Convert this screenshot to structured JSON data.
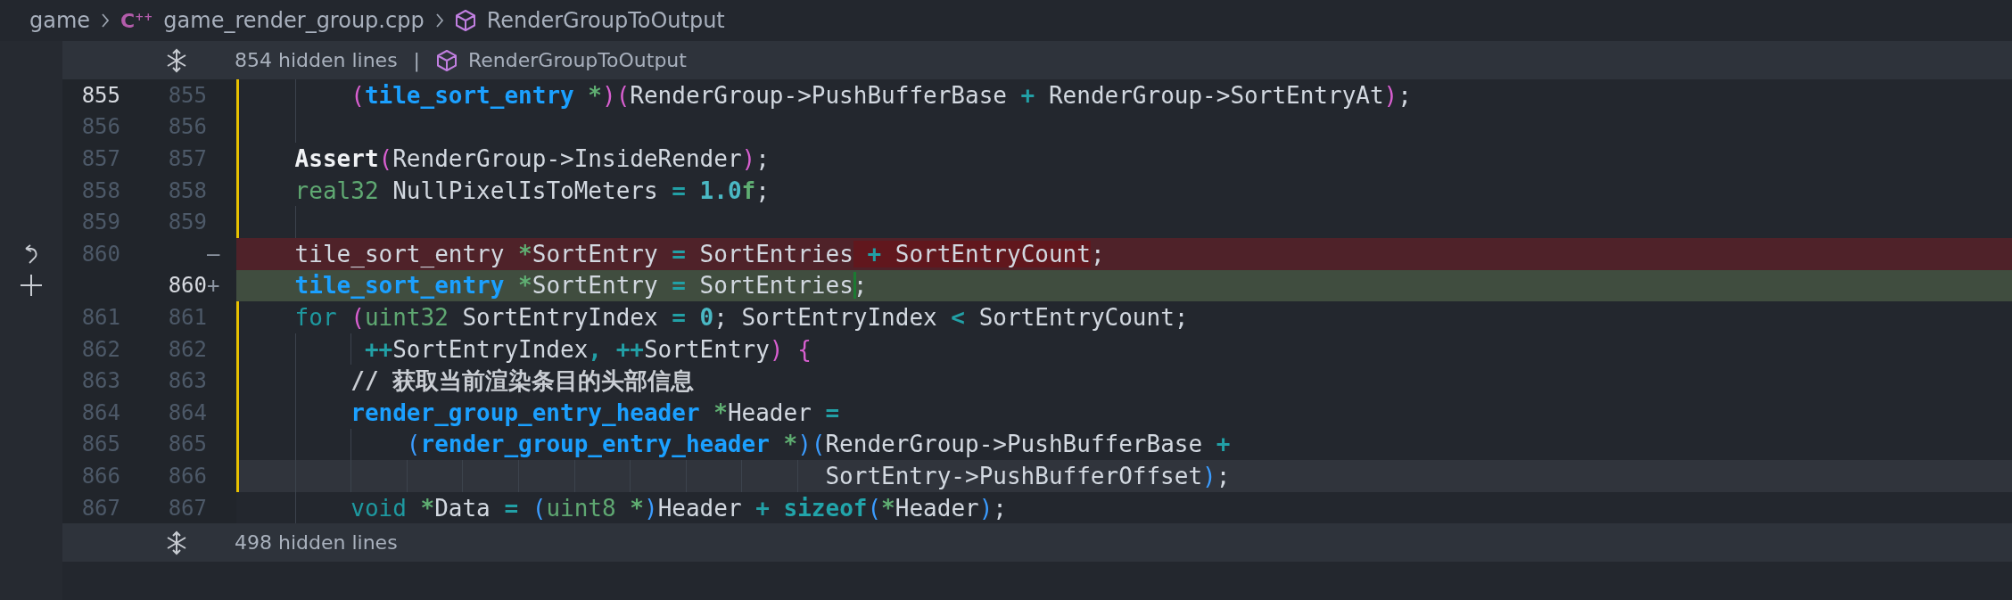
{
  "breadcrumb": [
    {
      "kind": "folder",
      "label": "game"
    },
    {
      "kind": "cpp-file",
      "badge": "C$^{++}$",
      "label": "game_render_group.cpp"
    },
    {
      "kind": "symbol",
      "label": "RenderGroupToOutput"
    }
  ],
  "fold_top": {
    "text": "854 hidden lines",
    "separator": "|",
    "symbol": "RenderGroupToOutput"
  },
  "lines": [
    {
      "kind": "context",
      "old": {
        "text": "855",
        "bright": true
      },
      "new": {
        "text": "855",
        "bright": false
      },
      "in_change_block": true,
      "current": false,
      "tokens": [
        {
          "t": "        (",
          "kind": "paren1"
        },
        {
          "t": "tile_sort_entry ",
          "kind": "type"
        },
        {
          "t": "*",
          "kind": "ptr"
        },
        {
          "t": ")(",
          "kind": "paren1"
        },
        {
          "t": "RenderGroup->PushBufferBase "
        },
        {
          "t": "+ ",
          "kind": "op"
        },
        {
          "t": "RenderGroup->SortEntryAt"
        },
        {
          "t": ")",
          "kind": "paren1"
        },
        {
          "t": ";"
        }
      ]
    },
    {
      "kind": "context",
      "old": {
        "text": "856",
        "bright": false
      },
      "new": {
        "text": "856",
        "bright": false
      },
      "in_change_block": true,
      "current": false
    },
    {
      "kind": "context",
      "old": {
        "text": "857",
        "bright": false
      },
      "new": {
        "text": "857",
        "bright": false
      },
      "in_change_block": true,
      "current": false,
      "tokens": [
        {
          "t": "    Assert",
          "kind": "fn"
        },
        {
          "t": "(",
          "kind": "paren1"
        },
        {
          "t": "RenderGroup->InsideRender"
        },
        {
          "t": ")",
          "kind": "paren1"
        },
        {
          "t": ";"
        }
      ]
    },
    {
      "kind": "context",
      "old": {
        "text": "858",
        "bright": false
      },
      "new": {
        "text": "858",
        "bright": false
      },
      "in_change_block": true,
      "current": false,
      "tokens": [
        {
          "t": "    real32",
          "kind": "prim"
        },
        {
          "t": " NullPixelIsToMeters "
        },
        {
          "t": "= ",
          "kind": "op"
        },
        {
          "t": "1.0",
          "kind": "num"
        },
        {
          "t": "f",
          "kind": "suffix"
        },
        {
          "t": ";"
        }
      ]
    },
    {
      "kind": "context",
      "old": {
        "text": "859",
        "bright": false
      },
      "new": {
        "text": "859",
        "bright": false
      },
      "in_change_block": true,
      "current": false
    },
    {
      "kind": "deleted",
      "old": {
        "text": "860",
        "bright": false
      },
      "marker": "—",
      "in_change_block": false,
      "current": false,
      "tokens": [
        {
          "t": "    tile_sort_entry "
        },
        {
          "t": "*",
          "kind": "ptr"
        },
        {
          "t": "SortEntry "
        },
        {
          "t": "= ",
          "kind": "op"
        },
        {
          "t": "SortEntries"
        },
        {
          "t": " +",
          "kind": "op",
          "changed": true
        },
        {
          "t": " SortEntryCount",
          "changed": true
        },
        {
          "t": ";"
        }
      ]
    },
    {
      "kind": "added",
      "new": {
        "text": "860",
        "bright": true
      },
      "marker": "+",
      "in_change_block": false,
      "current": false,
      "tokens": [
        {
          "t": "    tile_sort_entry ",
          "kind": "type"
        },
        {
          "t": "*",
          "kind": "ptr"
        },
        {
          "t": "SortEntry "
        },
        {
          "t": "= ",
          "kind": "op"
        },
        {
          "t": "SortEntries"
        },
        {
          "t": ";",
          "changed": true
        }
      ]
    },
    {
      "kind": "context",
      "old": {
        "text": "861",
        "bright": false
      },
      "new": {
        "text": "861",
        "bright": false
      },
      "in_change_block": true,
      "current": false,
      "tokens": [
        {
          "t": "    for ",
          "kind": "kw"
        },
        {
          "t": "(",
          "kind": "paren1"
        },
        {
          "t": "uint32",
          "kind": "prim"
        },
        {
          "t": " SortEntryIndex "
        },
        {
          "t": "= ",
          "kind": "op"
        },
        {
          "t": "0",
          "kind": "num"
        },
        {
          "t": "; SortEntryIndex "
        },
        {
          "t": "< ",
          "kind": "op"
        },
        {
          "t": "SortEntryCount;"
        }
      ]
    },
    {
      "kind": "context",
      "old": {
        "text": "862",
        "bright": false
      },
      "new": {
        "text": "862",
        "bright": false
      },
      "in_change_block": true,
      "current": false,
      "tokens": [
        {
          "t": "         ++",
          "kind": "op"
        },
        {
          "t": "SortEntryIndex"
        },
        {
          "t": ", ++",
          "kind": "op"
        },
        {
          "t": "SortEntry"
        },
        {
          "t": ") {",
          "kind": "paren1"
        }
      ]
    },
    {
      "kind": "context",
      "old": {
        "text": "863",
        "bright": false
      },
      "new": {
        "text": "863",
        "bright": false
      },
      "in_change_block": true,
      "current": false,
      "tokens": [
        {
          "t": "        // 获取当前渲染条目的头部信息",
          "kind": "comment"
        }
      ]
    },
    {
      "kind": "context",
      "old": {
        "text": "864",
        "bright": false
      },
      "new": {
        "text": "864",
        "bright": false
      },
      "in_change_block": true,
      "current": false,
      "tokens": [
        {
          "t": "        render_group_entry_header ",
          "kind": "type"
        },
        {
          "t": "*",
          "kind": "ptr"
        },
        {
          "t": "Header "
        },
        {
          "t": "=",
          "kind": "op"
        }
      ]
    },
    {
      "kind": "context",
      "old": {
        "text": "865",
        "bright": false
      },
      "new": {
        "text": "865",
        "bright": false
      },
      "in_change_block": true,
      "current": false,
      "tokens": [
        {
          "t": "            (",
          "kind": "paren2"
        },
        {
          "t": "render_group_entry_header ",
          "kind": "type"
        },
        {
          "t": "*",
          "kind": "ptr"
        },
        {
          "t": ")(",
          "kind": "paren2"
        },
        {
          "t": "RenderGroup->PushBufferBase "
        },
        {
          "t": "+",
          "kind": "op"
        }
      ]
    },
    {
      "kind": "context",
      "old": {
        "text": "866",
        "bright": false
      },
      "new": {
        "text": "866",
        "bright": false
      },
      "in_change_block": true,
      "current": true,
      "tokens": [
        {
          "t": "                                          SortEntry->PushBufferOffset"
        },
        {
          "t": ")",
          "kind": "paren2"
        },
        {
          "t": ";"
        }
      ]
    },
    {
      "kind": "context",
      "old": {
        "text": "867",
        "bright": false
      },
      "new": {
        "text": "867",
        "bright": false
      },
      "in_change_block": false,
      "current": false,
      "tokens": [
        {
          "t": "        void ",
          "kind": "kw"
        },
        {
          "t": "*",
          "kind": "ptr"
        },
        {
          "t": "Data "
        },
        {
          "t": "= ",
          "kind": "op"
        },
        {
          "t": "(",
          "kind": "paren2"
        },
        {
          "t": "uint8 ",
          "kind": "prim"
        },
        {
          "t": "*",
          "kind": "ptr"
        },
        {
          "t": ")",
          "kind": "paren2"
        },
        {
          "t": "Header "
        },
        {
          "t": "+ ",
          "kind": "op"
        },
        {
          "t": "sizeof",
          "kind": "builtin"
        },
        {
          "t": "(",
          "kind": "paren2"
        },
        {
          "t": "*",
          "kind": "ptr"
        },
        {
          "t": "Header"
        },
        {
          "t": ")",
          "kind": "paren2"
        },
        {
          "t": ";"
        }
      ]
    }
  ],
  "fold_bottom": {
    "text": "498 hidden lines"
  }
}
